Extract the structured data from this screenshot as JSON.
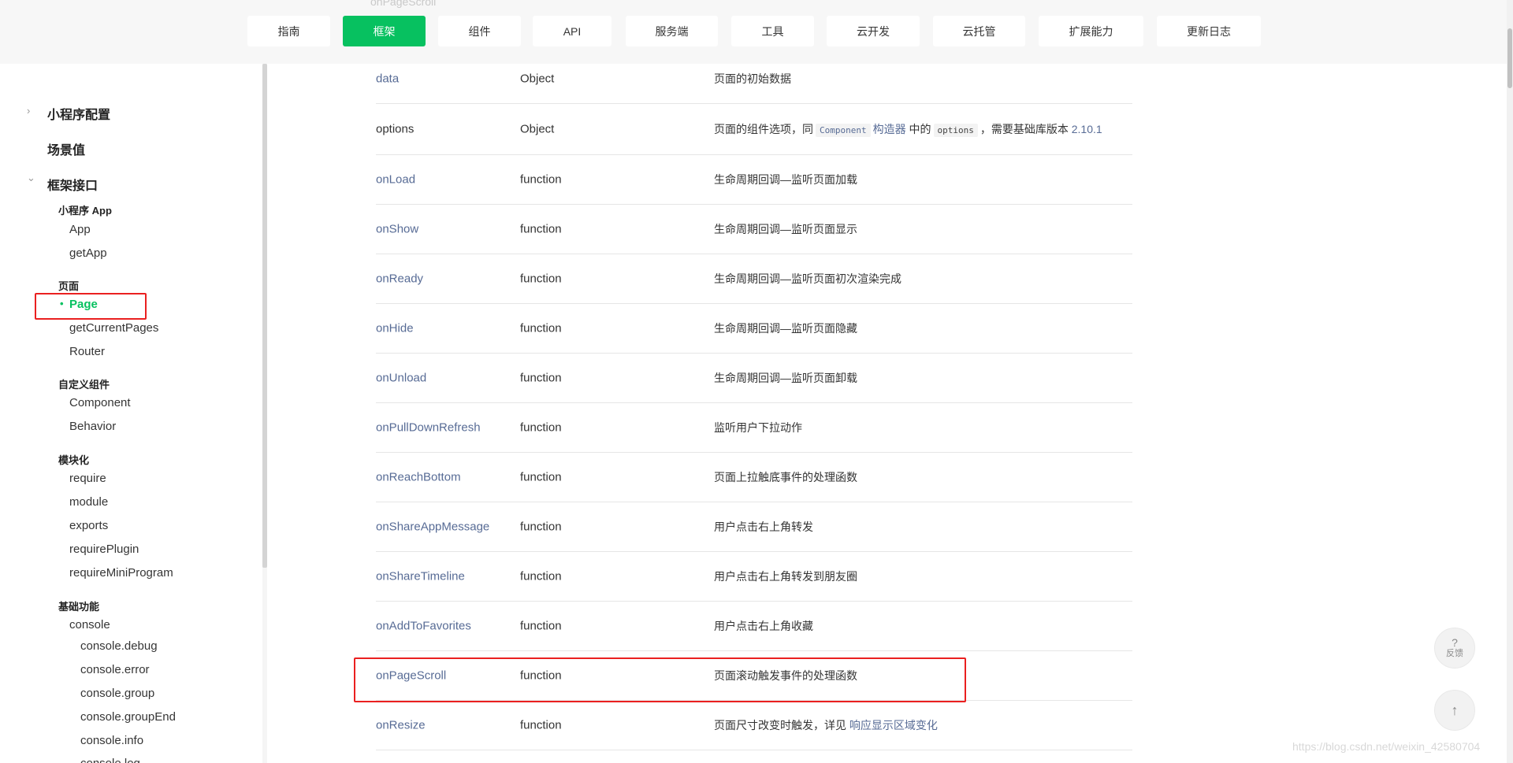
{
  "topnav": {
    "cut_text": "onPageScroll",
    "tabs": [
      {
        "label": "指南"
      },
      {
        "label": "框架"
      },
      {
        "label": "组件"
      },
      {
        "label": "API"
      },
      {
        "label": "服务端"
      },
      {
        "label": "工具"
      },
      {
        "label": "云开发"
      },
      {
        "label": "云托管"
      },
      {
        "label": "扩展能力"
      },
      {
        "label": "更新日志"
      }
    ],
    "accent_color": "#07c160"
  },
  "sidebar": {
    "sections": [
      {
        "label": "小程序配置",
        "arrow": "›"
      },
      {
        "label": "场景值"
      },
      {
        "label": "框架接口",
        "arrow": "⌄"
      }
    ],
    "groups": [
      {
        "label": "小程序 App",
        "items": [
          "App",
          "getApp"
        ]
      },
      {
        "label": "页面",
        "items": [
          "Page",
          "getCurrentPages",
          "Router"
        ]
      },
      {
        "label": "自定义组件",
        "items": [
          "Component",
          "Behavior"
        ]
      },
      {
        "label": "模块化",
        "items": [
          "require",
          "module",
          "exports",
          "requirePlugin",
          "requireMiniProgram"
        ]
      },
      {
        "label": "基础功能",
        "items": [
          "console",
          "console.debug",
          "console.error",
          "console.group",
          "console.groupEnd",
          "console.info",
          "console.log"
        ]
      }
    ],
    "active_item": "Page",
    "bullet": "•"
  },
  "table": {
    "rows": [
      {
        "name": "data",
        "type": "Object",
        "desc": "页面的初始数据"
      },
      {
        "name": "options",
        "type": "Object",
        "desc_parts": [
          "页面的组件选项，同",
          "Component",
          "构造器",
          "中的",
          "options",
          "，需要基础库版本",
          "2.10.1"
        ]
      },
      {
        "name": "onLoad",
        "type": "function",
        "desc": "生命周期回调—监听页面加载"
      },
      {
        "name": "onShow",
        "type": "function",
        "desc": "生命周期回调—监听页面显示"
      },
      {
        "name": "onReady",
        "type": "function",
        "desc": "生命周期回调—监听页面初次渲染完成"
      },
      {
        "name": "onHide",
        "type": "function",
        "desc": "生命周期回调—监听页面隐藏"
      },
      {
        "name": "onUnload",
        "type": "function",
        "desc": "生命周期回调—监听页面卸载"
      },
      {
        "name": "onPullDownRefresh",
        "type": "function",
        "desc": "监听用户下拉动作"
      },
      {
        "name": "onReachBottom",
        "type": "function",
        "desc": "页面上拉触底事件的处理函数"
      },
      {
        "name": "onShareAppMessage",
        "type": "function",
        "desc": "用户点击右上角转发"
      },
      {
        "name": "onShareTimeline",
        "type": "function",
        "desc": "用户点击右上角转发到朋友圈"
      },
      {
        "name": "onAddToFavorites",
        "type": "function",
        "desc": "用户点击右上角收藏"
      },
      {
        "name": "onPageScroll",
        "type": "function",
        "desc": "页面滚动触发事件的处理函数"
      },
      {
        "name": "onResize",
        "type": "function",
        "desc_parts": [
          "页面尺寸改变时触发，详见",
          "响应显示区域变化"
        ]
      }
    ]
  },
  "float_buttons": {
    "feedback_icon": "?",
    "feedback_label": "反馈",
    "top_icon": "↑"
  },
  "watermark": "https://blog.csdn.net/weixin_42580704"
}
